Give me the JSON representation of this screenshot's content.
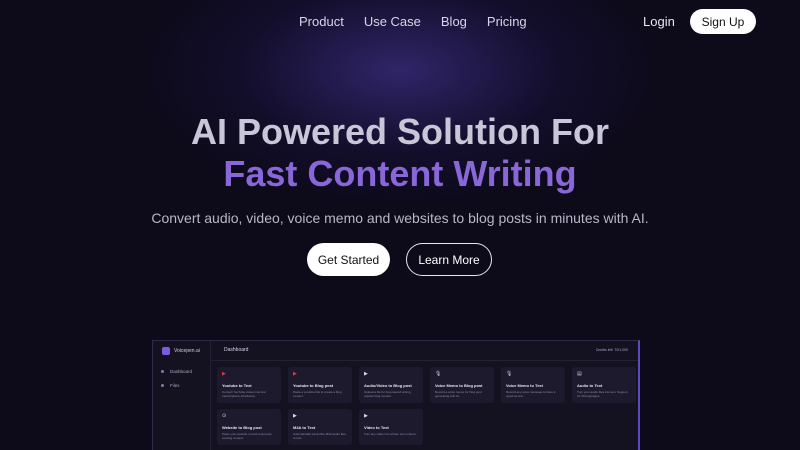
{
  "nav": {
    "links": [
      "Product",
      "Use Case",
      "Blog",
      "Pricing"
    ],
    "login": "Login",
    "signup": "Sign Up"
  },
  "hero": {
    "title_line1": "AI Powered Solution For",
    "title_line2": "Fast Content Writing",
    "subtitle": "Convert audio, video, voice memo and websites to blog posts in minutes with AI.",
    "cta_primary": "Get Started",
    "cta_secondary": "Learn More"
  },
  "dashboard": {
    "brand": "Voicepen.ai",
    "sidebar": [
      "Dashboard",
      "Files"
    ],
    "title": "Dashboard",
    "credits": "Credits left: 70/1,000",
    "cards": [
      {
        "icon": "▶",
        "title": "Youtube to Text",
        "desc": "Convert YouTube videos into text transcriptions effortlessly."
      },
      {
        "icon": "▶",
        "title": "Youtube to Blog post",
        "desc": "Paste a youtube link to create a blog content."
      },
      {
        "icon": "▶",
        "title": "Audio/Video to Blog post",
        "desc": "Upload a file for AI-powered writing organic blog content."
      },
      {
        "icon": "🎙",
        "title": "Voice Memo to Blog post",
        "desc": "Record a voice memo for blog post generating with AI."
      },
      {
        "icon": "🎙",
        "title": "Voice Memo to Text",
        "desc": "Record any voice message to have it typed as text."
      },
      {
        "icon": "▤",
        "title": "Audio to Text",
        "desc": "Turn your audio files into text. Support for 99 languages."
      }
    ],
    "cards2": [
      {
        "icon": "⊙",
        "title": "Website to Blog post",
        "desc": "Paste your website url and repurpose existing content."
      },
      {
        "icon": "▶",
        "title": "M4A to Text",
        "desc": "Automatically transcribe M4A audio files to text."
      },
      {
        "icon": "▶",
        "title": "Video to Text",
        "desc": "Turn any video into written text content."
      }
    ]
  }
}
